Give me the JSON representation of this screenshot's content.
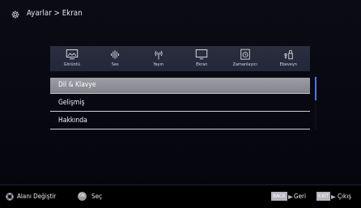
{
  "header": {
    "title": "Ayarlar > Ekran",
    "icon": "gear-icon"
  },
  "tabs": [
    {
      "label": "Görüntü",
      "icon": "picture-icon"
    },
    {
      "label": "Ses",
      "icon": "sound-icon"
    },
    {
      "label": "Yayın",
      "icon": "broadcast-icon"
    },
    {
      "label": "Ekran",
      "icon": "monitor-icon"
    },
    {
      "label": "Zamanlayıcı",
      "icon": "timer-icon"
    },
    {
      "label": "Ebeveyn",
      "icon": "parental-lock-icon"
    }
  ],
  "menu": {
    "items": [
      {
        "label": "Dil & Klavye",
        "selected": true
      },
      {
        "label": "Gelişmiş",
        "selected": false
      },
      {
        "label": "Hakkında",
        "selected": false
      }
    ]
  },
  "footer": {
    "nav_label": "Alanı Değiştir",
    "ok_button": "OK",
    "ok_label": "Seç",
    "back_button": "BACK",
    "back_label": "Geri",
    "exit_button": "EXIT",
    "exit_label": "Çıkış"
  },
  "colors": {
    "background": "#05060c",
    "tab_bar": "#2b2e3e",
    "selected_item": "#8f8f97",
    "scroll_thumb": "#4a77ff",
    "key_badge": "#b5b5bd"
  }
}
